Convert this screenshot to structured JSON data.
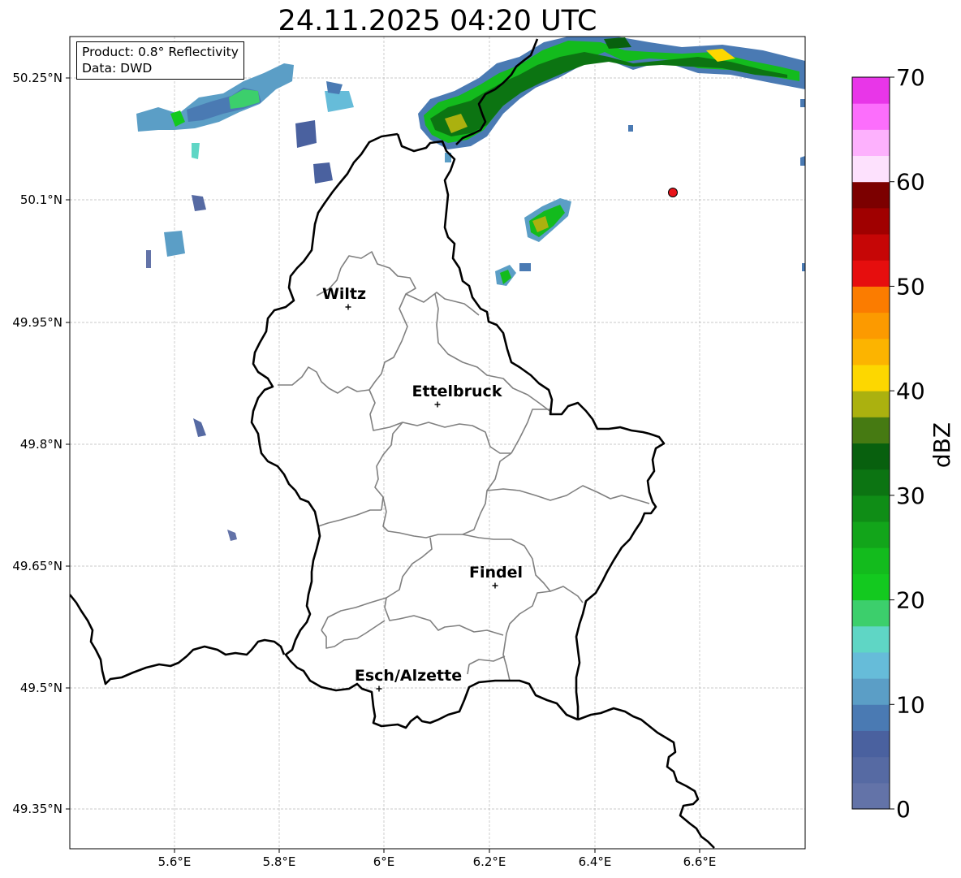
{
  "title": "24.11.2025 04:20 UTC",
  "info": {
    "product_line": "Product: 0.8° Reflectivity",
    "data_line": "Data: DWD"
  },
  "map": {
    "lon_ticks": [
      "5.6°E",
      "5.8°E",
      "6°E",
      "6.2°E",
      "6.4°E",
      "6.6°E"
    ],
    "lat_ticks": [
      "50.25°N",
      "50.1°N",
      "49.95°N",
      "49.8°N",
      "49.65°N",
      "49.5°N",
      "49.35°N"
    ],
    "cities": [
      {
        "name": "Wiltz"
      },
      {
        "name": "Ettelbruck"
      },
      {
        "name": "Findel"
      },
      {
        "name": "Esch/Alzette"
      }
    ],
    "radar_site_color": "#e8141a",
    "border_color": "#000000",
    "canton_color": "#808080"
  },
  "colorbar": {
    "label": "dBZ",
    "tick_labels": [
      "0",
      "10",
      "20",
      "30",
      "40",
      "50",
      "60",
      "70"
    ],
    "min": 0,
    "max": 70,
    "step": 2.5,
    "colors": [
      "#6373a8",
      "#566aa3",
      "#4a619f",
      "#4a7ab3",
      "#5b9ec6",
      "#66bcd9",
      "#5fd6c5",
      "#3ccf6c",
      "#13c91f",
      "#13bb1d",
      "#12a51a",
      "#0f8d16",
      "#0c7412",
      "#08600e",
      "#467a12",
      "#abb10f",
      "#fdd700",
      "#fcb400",
      "#fc9a00",
      "#fb7c00",
      "#e60e0e",
      "#c60606",
      "#a00000",
      "#7c0000",
      "#fde1fd",
      "#fdb1fd",
      "#fc6efc",
      "#e836e8"
    ]
  }
}
